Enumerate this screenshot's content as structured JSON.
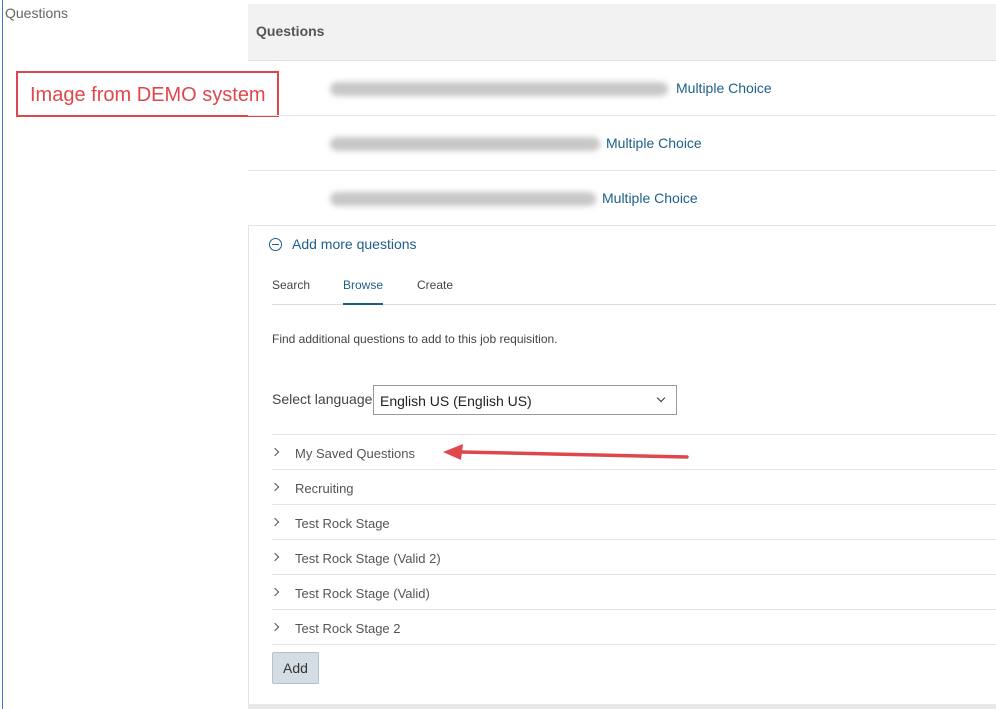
{
  "sidebar": {
    "label": "Questions"
  },
  "annotation": {
    "demo_label": "Image from DEMO system",
    "color": "#e0474c"
  },
  "questions": {
    "header": "Questions",
    "rows": [
      {
        "type": "Multiple Choice"
      },
      {
        "type": "Multiple Choice"
      },
      {
        "type": "Multiple Choice"
      }
    ]
  },
  "add_more": {
    "toggle_label": "Add more questions",
    "toggle_icon": "minus-circle-icon",
    "tabs": [
      {
        "label": "Search",
        "active": false
      },
      {
        "label": "Browse",
        "active": true
      },
      {
        "label": "Create",
        "active": false
      }
    ],
    "help_text": "Find additional questions to add to this job requisition.",
    "language": {
      "label": "Select language",
      "value": "English US (English US)"
    },
    "categories": [
      "My Saved Questions",
      "Recruiting",
      "Test Rock Stage",
      "Test Rock Stage (Valid 2)",
      "Test Rock Stage (Valid)",
      "Test Rock Stage 2"
    ],
    "add_button": "Add"
  },
  "colors": {
    "link": "#1e5f8a",
    "header_bg": "#f2f2f2",
    "button_bg": "#d5dde4"
  }
}
